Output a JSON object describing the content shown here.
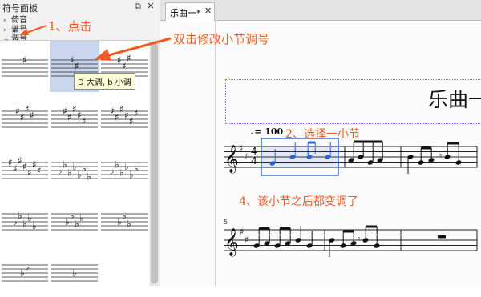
{
  "palette": {
    "title": "符号面板",
    "controls": "⧉ ✕",
    "categories": [
      {
        "label": "倚音",
        "expanded": false
      },
      {
        "label": "谱号",
        "expanded": false
      },
      {
        "label": "调号",
        "expanded": true
      }
    ],
    "tooltip": "D 大调, b 小调",
    "selected_key_index": 1
  },
  "tab": {
    "label": "乐曲一*",
    "close": "✕"
  },
  "score": {
    "title": "乐曲一",
    "tempo": "♩= 100",
    "measure_number": "5"
  },
  "annotations": {
    "step1": "1、点击",
    "double_click": "双击修改小节调号",
    "step2": "2、选择一小节",
    "step4": "4、该小节之后都变调了"
  },
  "colors": {
    "annotation": "#f15a24",
    "selection": "#3a6fd8",
    "palette_selection": "#c9d6ee"
  }
}
